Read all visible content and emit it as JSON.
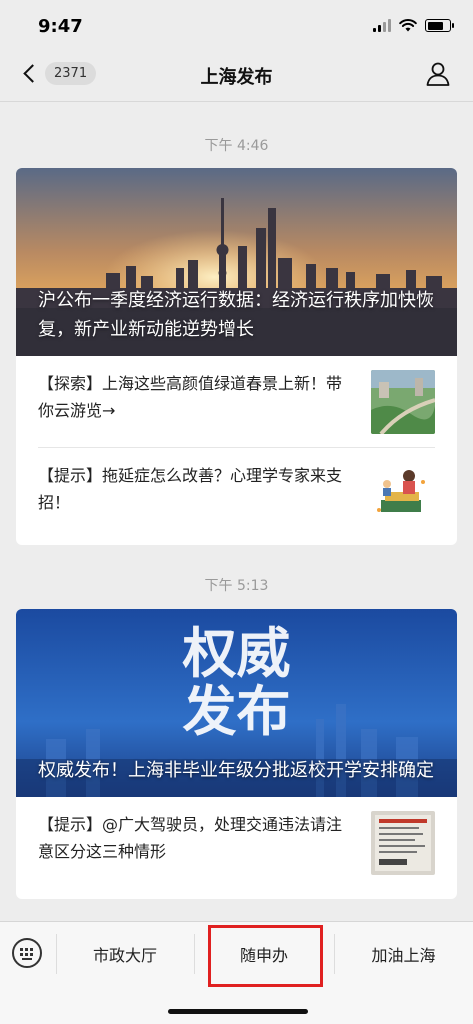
{
  "status_bar": {
    "time": "9:47",
    "icons": [
      "cellular-signal-icon",
      "wifi-icon",
      "battery-icon"
    ],
    "battery_level": 0.75
  },
  "nav": {
    "back_icon": "chevron-left-icon",
    "unread_count": "2371",
    "title": "上海发布",
    "profile_icon": "person-icon"
  },
  "feed": [
    {
      "time": "下午 4:46",
      "hero_title": "沪公布一季度经济运行数据：经济运行秩序加快恢复，新产业新动能逆势增长",
      "articles": [
        {
          "title": "【探索】上海这些高颜值绿道春景上新！带你云游览→",
          "thumb": "greenway-photo"
        },
        {
          "title": "【提示】拖延症怎么改善？心理学专家来支招！",
          "thumb": "procrastination-illustration"
        }
      ]
    },
    {
      "time": "下午 5:13",
      "hero_overlay_line1": "权威",
      "hero_overlay_line2": "发布",
      "hero_title": "权威发布！上海非毕业年级分批返校开学安排确定",
      "articles": [
        {
          "title": "【提示】@广大驾驶员，处理交通违法请注意区分这三种情形",
          "thumb": "traffic-document-photo"
        }
      ]
    }
  ],
  "bottom_menu": {
    "keyboard_icon": "keyboard-icon",
    "items": [
      "市政大厅",
      "随申办",
      "加油上海"
    ],
    "highlight_color": "#e02020"
  }
}
